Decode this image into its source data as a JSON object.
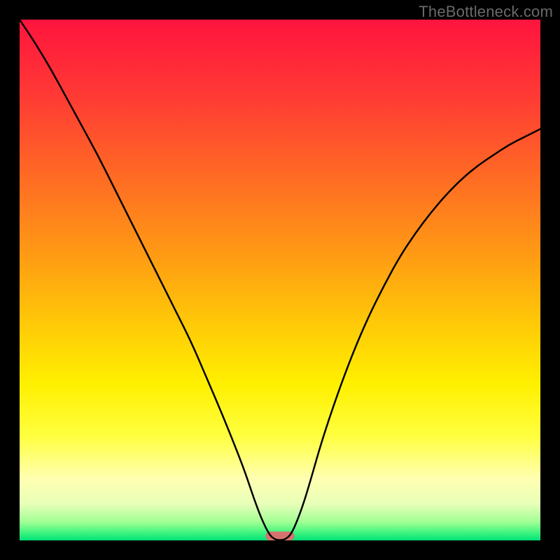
{
  "watermark": "TheBottleneck.com",
  "chart_data": {
    "type": "line",
    "title": "",
    "xlabel": "",
    "ylabel": "",
    "xlim": [
      0,
      100
    ],
    "ylim": [
      0,
      100
    ],
    "grid": false,
    "legend": false,
    "series": [
      {
        "name": "curve",
        "x": [
          0,
          3,
          6,
          9,
          12,
          15,
          18,
          21,
          24,
          27,
          30,
          33,
          36,
          39,
          42,
          43.5,
          45,
          46.5,
          48,
          49,
          50,
          51,
          52,
          53,
          54.5,
          56,
          58,
          61,
          64,
          67,
          70,
          73,
          76,
          79,
          82,
          85,
          88,
          91,
          94,
          97,
          100
        ],
        "y": [
          100,
          95.5,
          90.5,
          85,
          79.5,
          74,
          68,
          62,
          56,
          50,
          44,
          38,
          31,
          24,
          16.5,
          12.5,
          8,
          4,
          1,
          0.2,
          0,
          0.2,
          1,
          3,
          7,
          12,
          19,
          28,
          36,
          43,
          49,
          54.5,
          59,
          63,
          66.5,
          69.5,
          72,
          74,
          76,
          77.5,
          79
        ]
      }
    ],
    "marker": {
      "name": "min-marker",
      "x_center": 50,
      "width_pct": 5.5,
      "height_pct": 1.7,
      "color": "#d6726d"
    },
    "background_gradient": [
      {
        "pos": 0.0,
        "color": "#ff143e"
      },
      {
        "pos": 0.15,
        "color": "#ff3b34"
      },
      {
        "pos": 0.3,
        "color": "#ff6a24"
      },
      {
        "pos": 0.45,
        "color": "#ff9a14"
      },
      {
        "pos": 0.58,
        "color": "#ffc808"
      },
      {
        "pos": 0.7,
        "color": "#fff000"
      },
      {
        "pos": 0.8,
        "color": "#ffff40"
      },
      {
        "pos": 0.88,
        "color": "#ffffb0"
      },
      {
        "pos": 0.93,
        "color": "#e8ffb8"
      },
      {
        "pos": 0.965,
        "color": "#a0ff94"
      },
      {
        "pos": 0.985,
        "color": "#40f47f"
      },
      {
        "pos": 1.0,
        "color": "#00e178"
      }
    ]
  }
}
